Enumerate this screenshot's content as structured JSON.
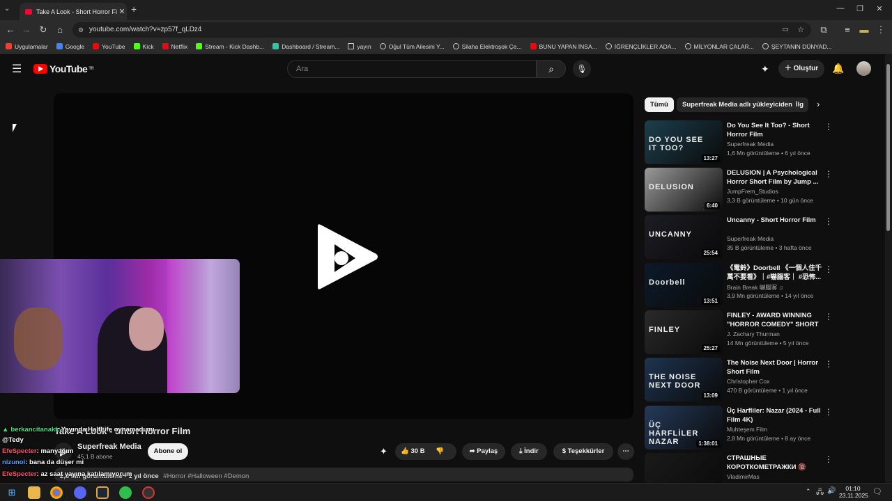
{
  "browser": {
    "tab_title": "Take A Look - Short Horror Film",
    "url": "youtube.com/watch?v=zp57f_qLDz4",
    "bookmarks": [
      {
        "label": "Uygulamalar",
        "icon": "apps-grid-icon",
        "color": "#ea4335"
      },
      {
        "label": "Google",
        "icon": "google-icon",
        "color": "#4285f4"
      },
      {
        "label": "YouTube",
        "icon": "youtube-icon",
        "color": "#ff0000"
      },
      {
        "label": "Kick",
        "icon": "kick-icon",
        "color": "#53fc18"
      },
      {
        "label": "Netflix",
        "icon": "netflix-icon",
        "color": "#e50914"
      },
      {
        "label": "Stream - Kick Dashb...",
        "icon": "kick-icon",
        "color": "#53fc18"
      },
      {
        "label": "Dashboard / Stream...",
        "icon": "streamlabs-icon",
        "color": "#31c3a2"
      },
      {
        "label": "yayın",
        "icon": "folder-icon",
        "color": "#cccccc"
      },
      {
        "label": "Oğul Tüm Ailesini Y...",
        "icon": "globe-icon",
        "color": "#cccccc"
      },
      {
        "label": "Silaha Elektroşok Çe...",
        "icon": "globe-icon",
        "color": "#cccccc"
      },
      {
        "label": "BUNU YAPAN İNSA...",
        "icon": "youtube-icon",
        "color": "#ff0000"
      },
      {
        "label": "İĞRENÇLİKLER ADA...",
        "icon": "globe-icon",
        "color": "#cccccc"
      },
      {
        "label": "MİLYONLAR ÇALAR...",
        "icon": "globe-icon",
        "color": "#cccccc"
      },
      {
        "label": "ŞEYTANIN DÜNYAD...",
        "icon": "globe-icon",
        "color": "#cccccc"
      }
    ]
  },
  "youtube": {
    "logo_text": "YouTube",
    "logo_region": "TR",
    "search_placeholder": "Ara",
    "create_label": "Oluştur"
  },
  "chips": [
    "Tümü",
    "Superfreak Media adlı yükleyiciden",
    "İlg"
  ],
  "recommendations": [
    {
      "title": "Do You See It Too? - Short Horror Film",
      "channel": "Superfreak Media",
      "meta": "1,6 Mn görüntüleme • 6 yıl önce",
      "duration": "13:27",
      "thumb_text": "DO YOU SEE IT TOO?",
      "thumb_color": "#1d3f4d"
    },
    {
      "title": "DELUSION | A Psychological Horror Short Film by Jump ...",
      "channel": "JumpFrem_Studios",
      "meta": "3,3 B görüntüleme • 10 gün önce",
      "duration": "6:40",
      "thumb_text": "DELUSION",
      "thumb_color": "#9a9a9a"
    },
    {
      "title": "Uncanny - Short Horror Film",
      "channel": "Superfreak Media",
      "meta": "35 B görüntüleme • 3 hafta önce",
      "duration": "25:54",
      "thumb_text": "UNCANNY",
      "thumb_color": "#1c1c24"
    },
    {
      "title": "《電鈴》Doorbell 《一個人住千萬不要看》｜#嚇腦客｜ #恐怖...",
      "channel": "Brain Break 嚇腦客 ♫",
      "meta": "3,9 Mn görüntüleme • 14 yıl önce",
      "duration": "13:51",
      "thumb_text": "Doorbell",
      "thumb_color": "#0d1a2a"
    },
    {
      "title": "FINLEY - AWARD WINNING \"HORROR COMEDY\" SHORT ...",
      "channel": "J. Zachary Thurman",
      "meta": "14 Mn görüntüleme • 5 yıl önce",
      "duration": "25:27",
      "thumb_text": "FINLEY",
      "thumb_color": "#2a2a2a"
    },
    {
      "title": "The Noise Next Door | Horror Short Film",
      "channel": "Christopher Cox",
      "meta": "470 B görüntüleme • 1 yıl önce",
      "duration": "13:09",
      "thumb_text": "THE NOISE NEXT DOOR",
      "thumb_color": "#1e3450"
    },
    {
      "title": "Üç Harfliler: Nazar (2024 - Full Film 4K)",
      "channel": "Muhteşem Film",
      "meta": "2,8 Mn görüntüleme • 8 ay önce",
      "duration": "1:38:01",
      "thumb_text": "ÜÇ HARFLİLER NAZAR",
      "thumb_color": "#243a5a"
    },
    {
      "title": "СТРАШНЫЕ КОРОТКОМЕТРАЖКИ 🔞 .ТО...",
      "channel": "VladimirMas",
      "meta": "",
      "duration": "",
      "thumb_text": "",
      "thumb_color": "#1a1a1a"
    }
  ],
  "video": {
    "title": "Take A Look - Short Horror Film",
    "channel": "Superfreak Media",
    "subscribers": "45,1 B abone",
    "subscribe_label": "Abone ol",
    "likes": "30 B",
    "share_label": "Paylaş",
    "download_label": "İndir",
    "thanks_label": "Teşekkürler",
    "description_meta": "2,3 Mn görüntüleme • 1 yıl önce",
    "hashtags": "#Horror #Halloween #Demon"
  },
  "chat": [
    {
      "user": "berkancitanakl",
      "message": ": Yayında HalfLife oynamadı mı",
      "color": "#4ade80",
      "badge": "●"
    },
    {
      "user": "",
      "message": "@Tedy",
      "color": "#ffffff",
      "badge": ""
    },
    {
      "user": "EfeSpecter",
      "message": ": manyağım",
      "color": "#ff4d6d",
      "badge": ""
    },
    {
      "user": "nizunoi",
      "message": ": bana da düşer mi",
      "color": "#5aa0ff",
      "badge": ""
    },
    {
      "user": "EfeSpecter",
      "message": ": az saat yayına katılamıyorum",
      "color": "#ff4d6d",
      "badge": ""
    }
  ],
  "taskbar": {
    "time": "01:10",
    "date": "23.11.2025"
  }
}
